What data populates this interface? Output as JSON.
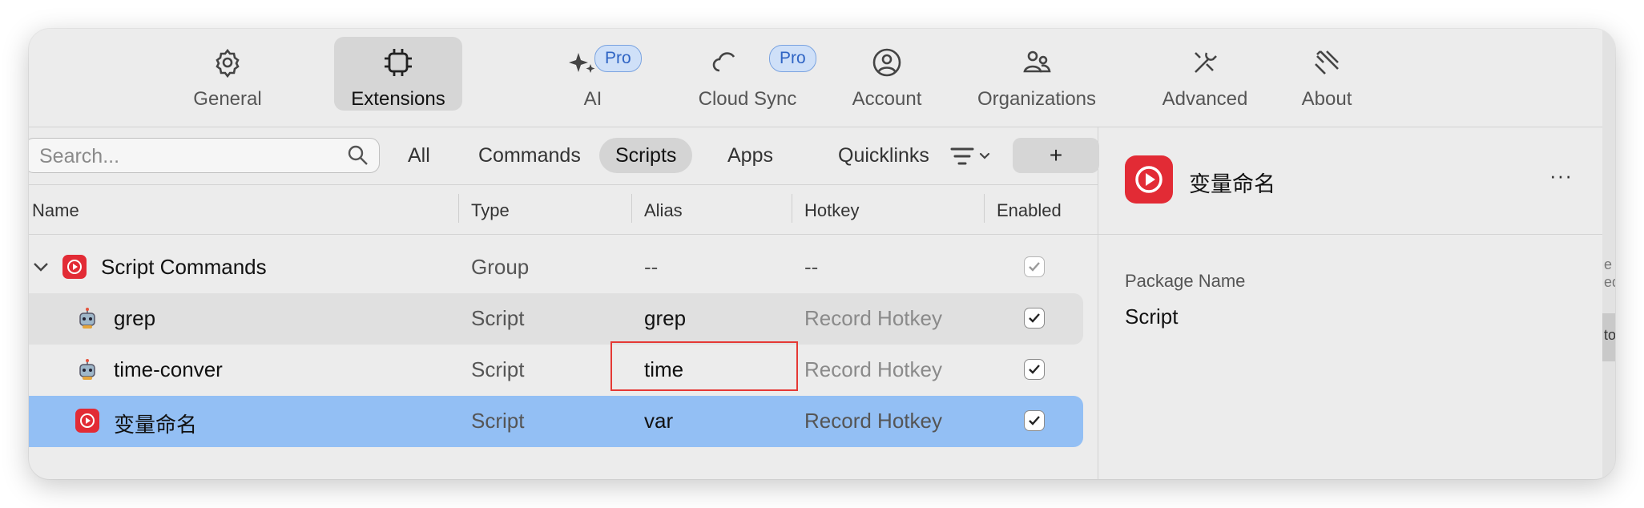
{
  "toolbar": {
    "tabs": [
      {
        "label": "General",
        "icon": "gear-icon"
      },
      {
        "label": "Extensions",
        "icon": "chip-icon",
        "active": true
      },
      {
        "label": "AI",
        "icon": "sparkles-icon",
        "badge": "Pro"
      },
      {
        "label": "Cloud Sync",
        "icon": "cloud-icon",
        "badge": "Pro"
      },
      {
        "label": "Account",
        "icon": "person-circle-icon"
      },
      {
        "label": "Organizations",
        "icon": "people-icon"
      },
      {
        "label": "Advanced",
        "icon": "tools-icon"
      },
      {
        "label": "About",
        "icon": "raycast-logo-icon"
      }
    ]
  },
  "filter": {
    "search_placeholder": "Search...",
    "tabs": [
      "All",
      "Commands",
      "Scripts",
      "Apps",
      "Quicklinks"
    ],
    "active_tab": "Scripts",
    "add_label": "+"
  },
  "table": {
    "columns": [
      "Name",
      "Type",
      "Alias",
      "Hotkey",
      "Enabled"
    ],
    "rows": [
      {
        "name": "Script Commands",
        "type": "Group",
        "alias": "--",
        "hotkey": "--",
        "enabled": true,
        "icon": "script-commands-icon",
        "expanded": true
      },
      {
        "name": "grep",
        "type": "Script",
        "alias": "grep",
        "hotkey": "Record Hotkey",
        "enabled": true,
        "icon": "robot-icon"
      },
      {
        "name": "time-conver",
        "type": "Script",
        "alias": "time",
        "hotkey": "Record Hotkey",
        "enabled": true,
        "icon": "robot-icon"
      },
      {
        "name": "变量命名",
        "type": "Script",
        "alias": "var",
        "hotkey": "Record Hotkey",
        "enabled": true,
        "icon": "play-circle-icon",
        "selected": true
      }
    ]
  },
  "detail": {
    "title": "变量命名",
    "more_label": "···",
    "package_name_label": "Package Name",
    "package_name_value": "Script"
  },
  "edge": {
    "t1": "e",
    "t2": "ed",
    "t3": "to"
  },
  "colors": {
    "accent": "#e22b35",
    "selection": "#93bff4",
    "pro_badge": "#cfe0f8",
    "highlight_box": "#e53935"
  }
}
